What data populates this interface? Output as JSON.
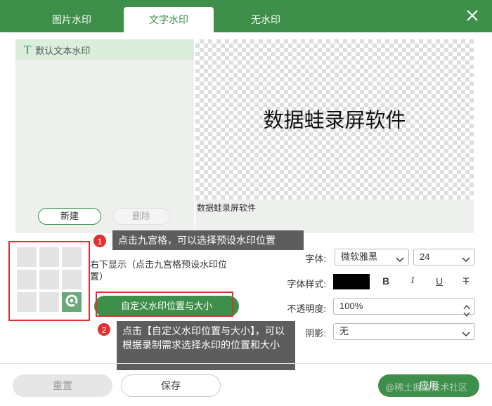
{
  "tabs": [
    {
      "label": "图片水印",
      "active": false
    },
    {
      "label": "文字水印",
      "active": true
    },
    {
      "label": "无水印",
      "active": false
    }
  ],
  "accent_color": "#3d8f4a",
  "list": {
    "items": [
      {
        "icon": "T",
        "label": "默认文本水印"
      }
    ],
    "new_label": "新建",
    "delete_label": "删除"
  },
  "preview": {
    "watermark_text": "数据蛙录屏软件",
    "caption": "数据蛙录屏软件"
  },
  "position": {
    "text": "右下显示（点击九宫格预设水印位置）",
    "selected_cell": 8,
    "custom_button": "自定义水印位置与大小"
  },
  "callouts": [
    {
      "number": "1",
      "text": "点击九宫格，可以选择预设水印位置"
    },
    {
      "number": "2",
      "text": "点击【自定义水印位置与大小】，可以根据录制需求选择水印的位置和大小"
    }
  ],
  "settings": {
    "font_label": "字体:",
    "font_value": "微软雅黑",
    "size_value": "24",
    "style_label": "字体样式:",
    "color": "#000000",
    "style_buttons": [
      "B",
      "I",
      "U",
      "T"
    ],
    "opacity_label": "不透明度:",
    "opacity_value": "100%",
    "shadow_label": "阴影:",
    "shadow_value": "无"
  },
  "footer": {
    "reset_label": "重置",
    "save_label": "保存",
    "apply_label": "应用"
  },
  "watermark": "@稀土掘金技术社区"
}
